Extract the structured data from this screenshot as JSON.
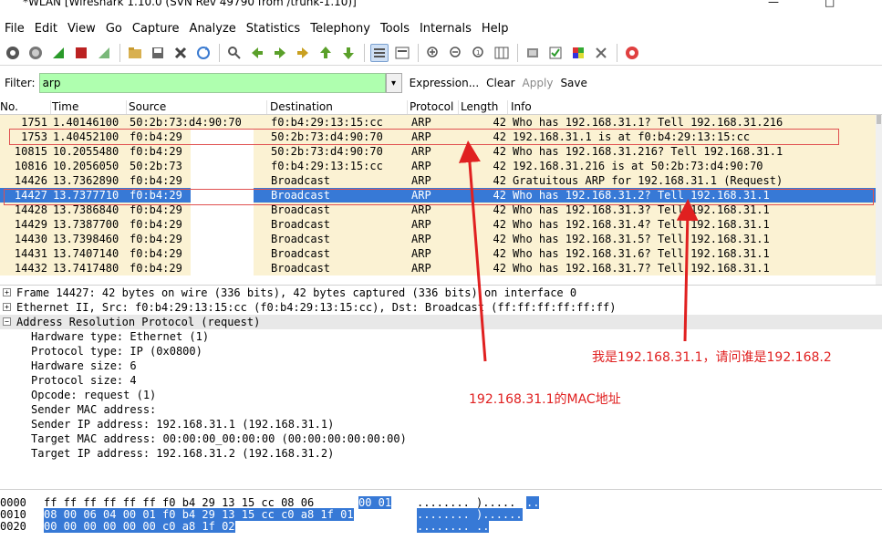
{
  "window": {
    "title": "*WLAN   [Wireshark 1.10.0  (SVN Rev 49790 from /trunk-1.10)]",
    "minimize": "—",
    "maximize": "□"
  },
  "menu": [
    "File",
    "Edit",
    "View",
    "Go",
    "Capture",
    "Analyze",
    "Statistics",
    "Telephony",
    "Tools",
    "Internals",
    "Help"
  ],
  "filter": {
    "label": "Filter:",
    "value": "arp",
    "expression_label": "Expression...",
    "clear_label": "Clear",
    "apply_label": "Apply",
    "save_label": "Save"
  },
  "columns": [
    "No.",
    "Time",
    "Source",
    "Destination",
    "Protocol",
    "Length",
    "Info"
  ],
  "packets": [
    {
      "no": "1751",
      "time": "1.40146100",
      "src": "50:2b:73:d4:90:70",
      "dst": "f0:b4:29:13:15:cc",
      "proto": "ARP",
      "len": "42",
      "info": "Who has 192.168.31.1?  Tell 192.168.31.216"
    },
    {
      "no": "1753",
      "time": "1.40452100",
      "src": "f0:b4:29",
      "dst": "50:2b:73:d4:90:70",
      "proto": "ARP",
      "len": "42",
      "info": "192.168.31.1 is at f0:b4:29:13:15:cc"
    },
    {
      "no": "10815",
      "time": "10.2055480",
      "src": "f0:b4:29",
      "dst": "50:2b:73:d4:90:70",
      "proto": "ARP",
      "len": "42",
      "info": "Who has 192.168.31.216?  Tell 192.168.31.1"
    },
    {
      "no": "10816",
      "time": "10.2056050",
      "src": "50:2b:73",
      "dst": "f0:b4:29:13:15:cc",
      "proto": "ARP",
      "len": "42",
      "info": "192.168.31.216 is at 50:2b:73:d4:90:70"
    },
    {
      "no": "14426",
      "time": "13.7362890",
      "src": "f0:b4:29",
      "dst": "Broadcast",
      "proto": "ARP",
      "len": "42",
      "info": "Gratuitous ARP for 192.168.31.1 (Request)"
    },
    {
      "no": "14427",
      "time": "13.7377710",
      "src": "f0:b4:29",
      "dst": "Broadcast",
      "proto": "ARP",
      "len": "42",
      "info": "Who has 192.168.31.2?  Tell 192.168.31.1"
    },
    {
      "no": "14428",
      "time": "13.7386840",
      "src": "f0:b4:29",
      "dst": "Broadcast",
      "proto": "ARP",
      "len": "42",
      "info": "Who has 192.168.31.3?  Tell 192.168.31.1"
    },
    {
      "no": "14429",
      "time": "13.7387700",
      "src": "f0:b4:29",
      "dst": "Broadcast",
      "proto": "ARP",
      "len": "42",
      "info": "Who has 192.168.31.4?  Tell 192.168.31.1"
    },
    {
      "no": "14430",
      "time": "13.7398460",
      "src": "f0:b4:29",
      "dst": "Broadcast",
      "proto": "ARP",
      "len": "42",
      "info": "Who has 192.168.31.5?  Tell 192.168.31.1"
    },
    {
      "no": "14431",
      "time": "13.7407140",
      "src": "f0:b4:29",
      "dst": "Broadcast",
      "proto": "ARP",
      "len": "42",
      "info": "Who has 192.168.31.6?  Tell 192.168.31.1"
    },
    {
      "no": "14432",
      "time": "13.7417480",
      "src": "f0:b4:29",
      "dst": "Broadcast",
      "proto": "ARP",
      "len": "42",
      "info": "Who has 192.168.31.7?  Tell 192.168.31.1"
    }
  ],
  "details": [
    "Frame 14427: 42 bytes on wire (336 bits), 42 bytes captured (336 bits) on interface 0",
    "Ethernet II, Src: f0:b4:29:13:15:cc (f0:b4:29:13:15:cc), Dst: Broadcast (ff:ff:ff:ff:ff:ff)",
    "Address Resolution Protocol (request)",
    "Hardware type: Ethernet (1)",
    "Protocol type: IP (0x0800)",
    "Hardware size: 6",
    "Protocol size: 4",
    "Opcode: request (1)",
    "Sender MAC address: ",
    "Sender IP address: 192.168.31.1 (192.168.31.1)",
    "Target MAC address: 00:00:00_00:00:00 (00:00:00:00:00:00)",
    "Target IP address: 192.168.31.2 (192.168.31.2)"
  ],
  "bytes": [
    {
      "offset": "0000",
      "hex_plain": "ff ff ff ff ff ff f0 b4  29 13 15 cc 08 06 ",
      "hex_hl": "00 01",
      "ascii_plain": "........ )..... ",
      "ascii_hl": "..",
      "full_hl": false
    },
    {
      "offset": "0010",
      "hex_plain": "",
      "hex_hl": "08 00 06 04 00 01 f0 b4  29 13 15 cc c0 a8 1f 01",
      "ascii_plain": "",
      "ascii_hl": "........ )......",
      "full_hl": true
    },
    {
      "offset": "0020",
      "hex_plain": "",
      "hex_hl": "00 00 00 00 00 00 c0 a8  1f 02",
      "ascii_plain": "",
      "ascii_hl": "........ ..",
      "full_hl": true
    }
  ],
  "annotations": {
    "note1": "我是192.168.31.1，请问谁是192.168.2",
    "note2": "192.168.31.1的MAC地址"
  },
  "colors": {
    "row_bg": "#fbf2d3",
    "selected": "#3779d6",
    "filter_bg": "#afffaf",
    "annotation": "#e02020"
  }
}
